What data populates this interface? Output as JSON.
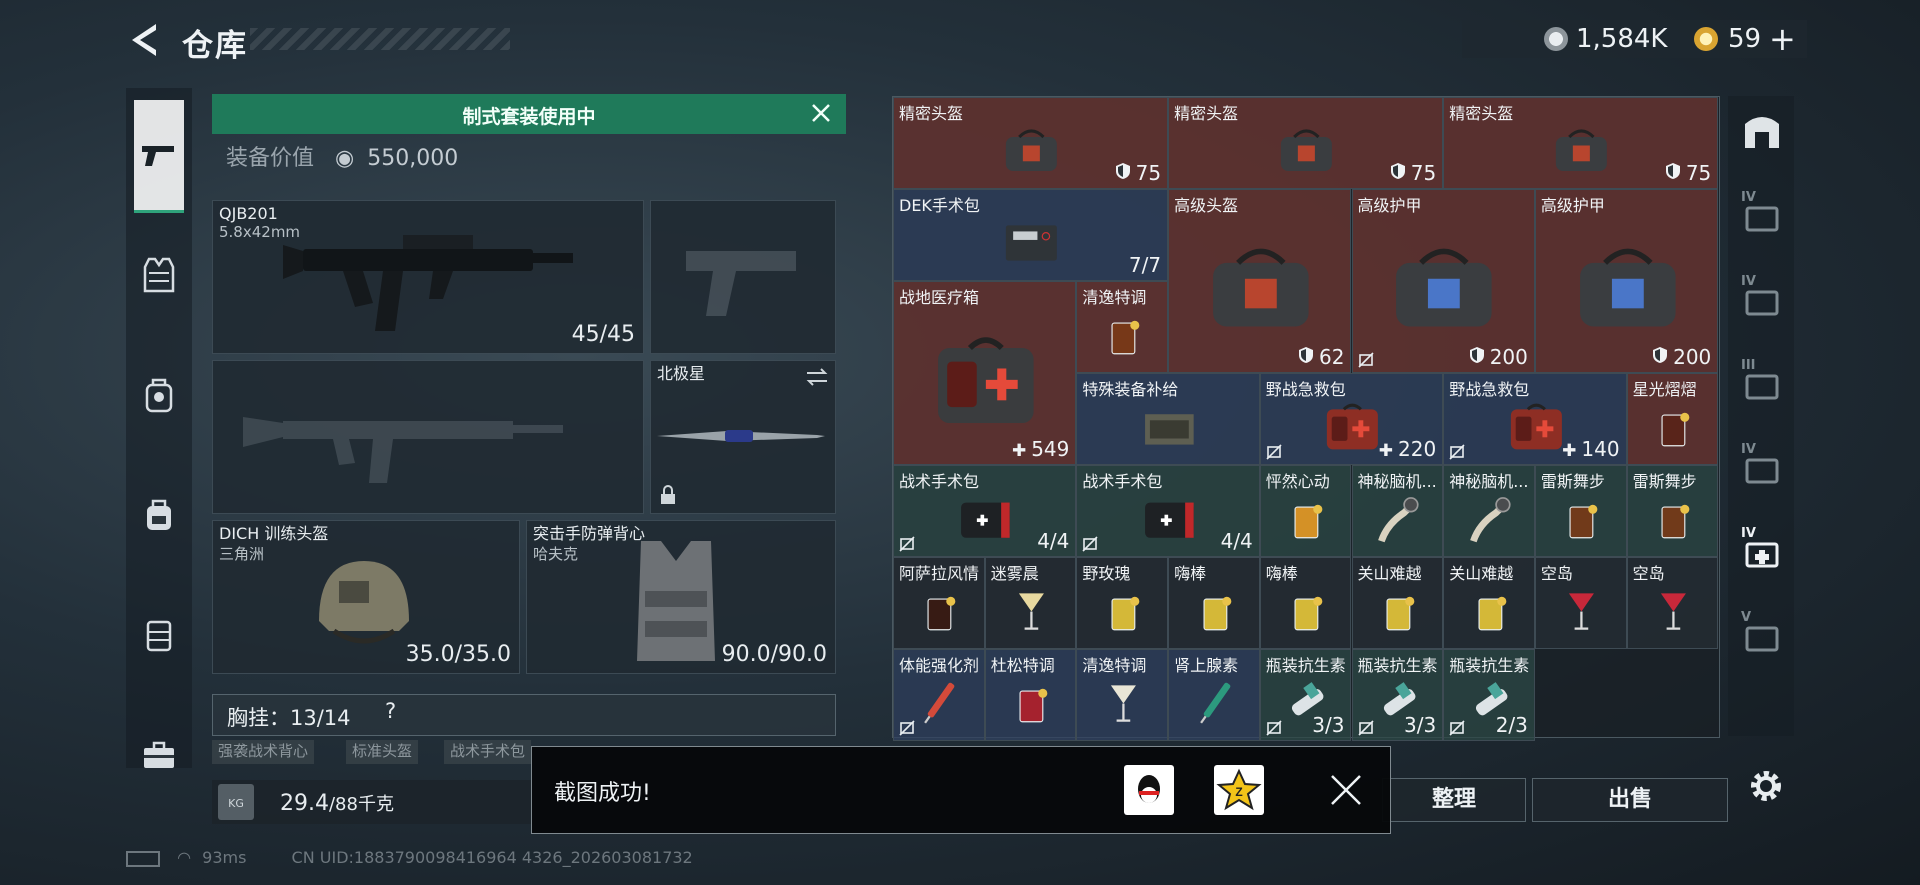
{
  "header": {
    "title": "仓库",
    "icons": {
      "back": "back-arrow-icon"
    }
  },
  "currency": {
    "silver": {
      "value": "1,584K",
      "icon": "silver-coin-icon",
      "color": "#c8cdd1"
    },
    "gold": {
      "value": "59",
      "icon": "gold-coin-icon",
      "color": "#e3b23c"
    },
    "plus": "+"
  },
  "left_nav": [
    {
      "icon": "pistol-icon",
      "active": true
    },
    {
      "icon": "vest-icon",
      "active": false
    },
    {
      "icon": "helmet-backpack-icon",
      "active": false
    },
    {
      "icon": "backpack-icon",
      "active": false
    },
    {
      "icon": "chest-rig-icon",
      "active": false
    },
    {
      "icon": "briefcase-icon",
      "active": false
    }
  ],
  "loadout": {
    "banner": "制式套装使用中",
    "equip_value_label": "装备价值",
    "equip_value": "550,000",
    "slots": {
      "primary": {
        "name": "QJB201",
        "caliber": "5.8x42mm",
        "count": "45/45"
      },
      "secondary_pistol": {
        "name": ""
      },
      "secondary_rifle": {
        "name": ""
      },
      "melee": {
        "name": "北极星"
      },
      "helmet": {
        "name": "DICH 训练头盔",
        "sub": "三角洲",
        "durability": "35.0/35.0"
      },
      "armor": {
        "name": "突击手防弹背心",
        "sub": "哈夫克",
        "durability": "90.0/90.0"
      }
    },
    "chest": {
      "label": "胸挂：13/14",
      "help": "?"
    },
    "chips": [
      "强袭战术背心",
      "标准头盔",
      "战术手术包"
    ],
    "weight": {
      "current": "29.4",
      "max": "/88千克",
      "icon_text": "KG"
    }
  },
  "status": {
    "ping": "93ms",
    "uid": "CN UID:1883790098416964 4326_202603081732"
  },
  "inventory": [
    {
      "name": "精密头盔",
      "count": "75",
      "type": "armor",
      "color": "red",
      "art": "bag"
    },
    {
      "name": "精密头盔",
      "count": "75",
      "type": "armor",
      "color": "red",
      "art": "bag"
    },
    {
      "name": "精密头盔",
      "count": "75",
      "type": "armor",
      "color": "red",
      "art": "bag"
    },
    {
      "name": "DEK手术包",
      "count": "7/7",
      "type": "plain",
      "color": "blue",
      "art": "surgkit"
    },
    {
      "name": "高级头盔",
      "count": "62",
      "type": "armor",
      "color": "red",
      "art": "bigbag"
    },
    {
      "name": "高级护甲",
      "count": "200",
      "type": "armor-nosell",
      "color": "red",
      "art": "bigbag-blue"
    },
    {
      "name": "高级护甲",
      "count": "200",
      "type": "armor",
      "color": "red",
      "art": "bigbag-blue"
    },
    {
      "name": "战地医疗箱",
      "count": "549",
      "type": "heal",
      "color": "red",
      "art": "medbox"
    },
    {
      "name": "清逸特调",
      "count": "",
      "type": "plain",
      "color": "red",
      "art": "drink-dark"
    },
    {
      "name": "特殊装备补给",
      "count": "",
      "type": "plain",
      "color": "blue",
      "art": "crate"
    },
    {
      "name": "野战急救包",
      "count": "220",
      "type": "heal-nosell",
      "color": "blue",
      "art": "aidkit"
    },
    {
      "name": "野战急救包",
      "count": "140",
      "type": "heal-nosell",
      "color": "blue",
      "art": "aidkit"
    },
    {
      "name": "星光熠熠",
      "count": "",
      "type": "plain",
      "color": "red",
      "art": "drink-mint"
    },
    {
      "name": "战术手术包",
      "count": "4/4",
      "type": "nosell",
      "color": "teal",
      "art": "pouch"
    },
    {
      "name": "战术手术包",
      "count": "4/4",
      "type": "nosell",
      "color": "teal",
      "art": "pouch"
    },
    {
      "name": "怦然心动",
      "count": "",
      "type": "plain",
      "color": "teal",
      "art": "drink-orange"
    },
    {
      "name": "神秘脑机...",
      "count": "",
      "type": "plain",
      "color": "teal",
      "art": "chip"
    },
    {
      "name": "神秘脑机...",
      "count": "",
      "type": "plain",
      "color": "teal",
      "art": "chip"
    },
    {
      "name": "雷斯舞步",
      "count": "",
      "type": "plain",
      "color": "teal",
      "art": "drink-dark"
    },
    {
      "name": "雷斯舞步",
      "count": "",
      "type": "plain",
      "color": "teal",
      "art": "drink-dark"
    },
    {
      "name": "阿萨拉风情",
      "count": "",
      "type": "plain",
      "color": "dark",
      "art": "drink-cola"
    },
    {
      "name": "迷雾晨",
      "count": "",
      "type": "plain",
      "color": "dark",
      "art": "drink-martini"
    },
    {
      "name": "野玫瑰",
      "count": "",
      "type": "plain",
      "color": "dark",
      "art": "drink-yellow"
    },
    {
      "name": "嗨棒",
      "count": "",
      "type": "plain",
      "color": "dark",
      "art": "drink-yellow"
    },
    {
      "name": "嗨棒",
      "count": "",
      "type": "plain",
      "color": "dark",
      "art": "drink-yellow"
    },
    {
      "name": "关山难越",
      "count": "",
      "type": "plain",
      "color": "dark",
      "art": "drink-yellow"
    },
    {
      "name": "关山难越",
      "count": "",
      "type": "plain",
      "color": "dark",
      "art": "drink-yellow"
    },
    {
      "name": "空岛",
      "count": "",
      "type": "plain",
      "color": "dark",
      "art": "drink-red"
    },
    {
      "name": "空岛",
      "count": "",
      "type": "plain",
      "color": "dark",
      "art": "drink-red"
    },
    {
      "name": "体能强化剂",
      "count": "",
      "type": "nosell-only",
      "color": "blue",
      "art": "syringe-red"
    },
    {
      "name": "杜松特调",
      "count": "",
      "type": "plain",
      "color": "blue",
      "art": "drink-redglass"
    },
    {
      "name": "清逸特调",
      "count": "",
      "type": "plain",
      "color": "blue",
      "art": "drink-flute"
    },
    {
      "name": "肾上腺素",
      "count": "",
      "type": "plain",
      "color": "blue",
      "art": "syringe-green"
    },
    {
      "name": "瓶装抗生素",
      "count": "3/3",
      "type": "nosell",
      "color": "teal",
      "art": "vial"
    },
    {
      "name": "瓶装抗生素",
      "count": "3/3",
      "type": "nosell",
      "color": "teal",
      "art": "vial"
    },
    {
      "name": "瓶装抗生素",
      "count": "2/3",
      "type": "nosell",
      "color": "teal",
      "art": "vial"
    }
  ],
  "right_bar": [
    {
      "icon": "vault-door-icon"
    },
    {
      "icon": "tier-4-case-icon",
      "label": "IV"
    },
    {
      "icon": "tier-4-recycle-icon",
      "label": "IV"
    },
    {
      "icon": "tier-3-tool-icon",
      "label": "III"
    },
    {
      "icon": "tier-4-box-icon",
      "label": "IV"
    },
    {
      "icon": "tier-4-medkit-add-icon",
      "label": "IV"
    },
    {
      "icon": "tier-5-case-icon",
      "label": "V"
    }
  ],
  "buttons": {
    "sort": "整理",
    "sell": "出售"
  },
  "toast": {
    "text": "截图成功!",
    "share": [
      "qq-share-icon",
      "qzone-share-icon"
    ],
    "qzone_glyph": "Z"
  }
}
